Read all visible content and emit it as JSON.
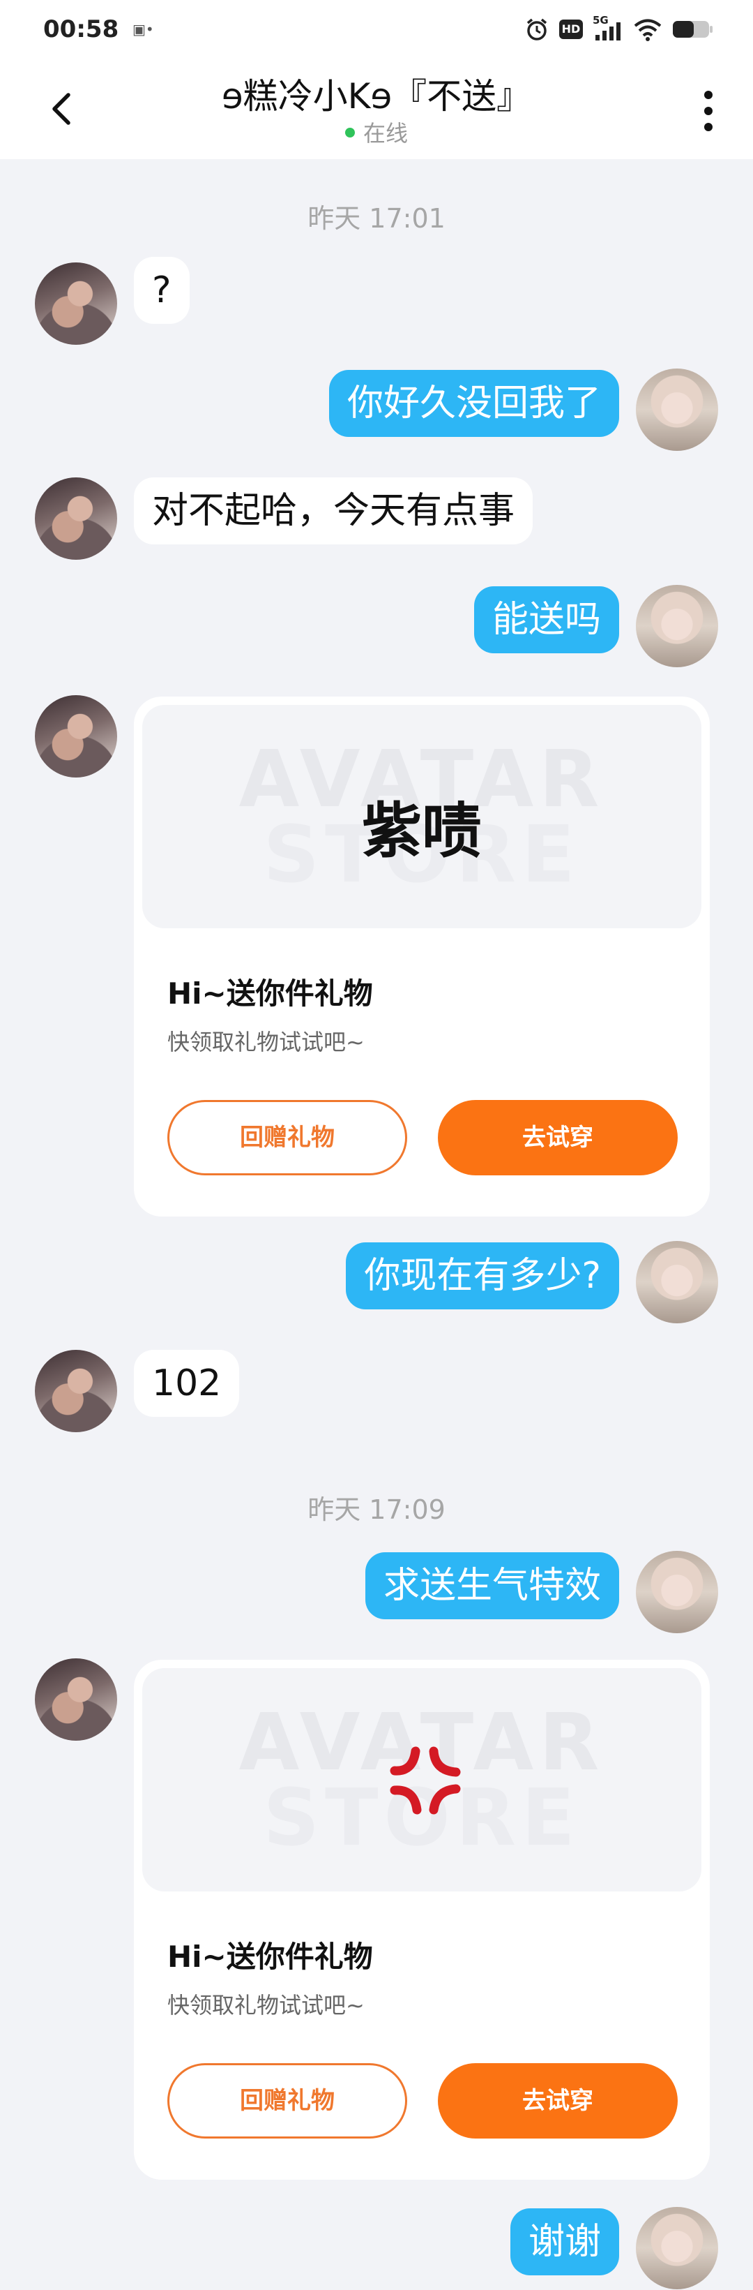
{
  "status_bar": {
    "time": "00:58",
    "small_icons": "▣•",
    "hd_label": "HD",
    "signal_label": "5G"
  },
  "header": {
    "title": "ɘ糕冷小Kɘ『不送』",
    "online_label": "在线"
  },
  "messages": {
    "ts1": "昨天 17:01",
    "m1": "?",
    "m2": "你好久没回我了",
    "m3": "对不起哈，今天有点事",
    "m4": "能送吗",
    "m6": "你现在有多少?",
    "m7": "102",
    "ts2": "昨天 17:09",
    "m8": "求送生气特效",
    "m10": "谢谢"
  },
  "gift_card_1": {
    "watermark_top": "AVATAR",
    "watermark_bottom": "STORE",
    "item_text": "紫啧",
    "title": "Hi~送你件礼物",
    "subtitle": "快领取礼物试试吧~",
    "return_label": "回赠礼物",
    "try_label": "去试穿"
  },
  "gift_card_2": {
    "watermark_top": "AVATAR",
    "watermark_bottom": "STORE",
    "item_icon": "anger-symbol-icon",
    "title": "Hi~送你件礼物",
    "subtitle": "快领取礼物试试吧~",
    "return_label": "回赠礼物",
    "try_label": "去试穿"
  },
  "colors": {
    "outgoing_bubble": "#2db6f5",
    "accent_orange": "#fb7313",
    "online_dot": "#2fc35a",
    "background": "#f2f3f7"
  }
}
